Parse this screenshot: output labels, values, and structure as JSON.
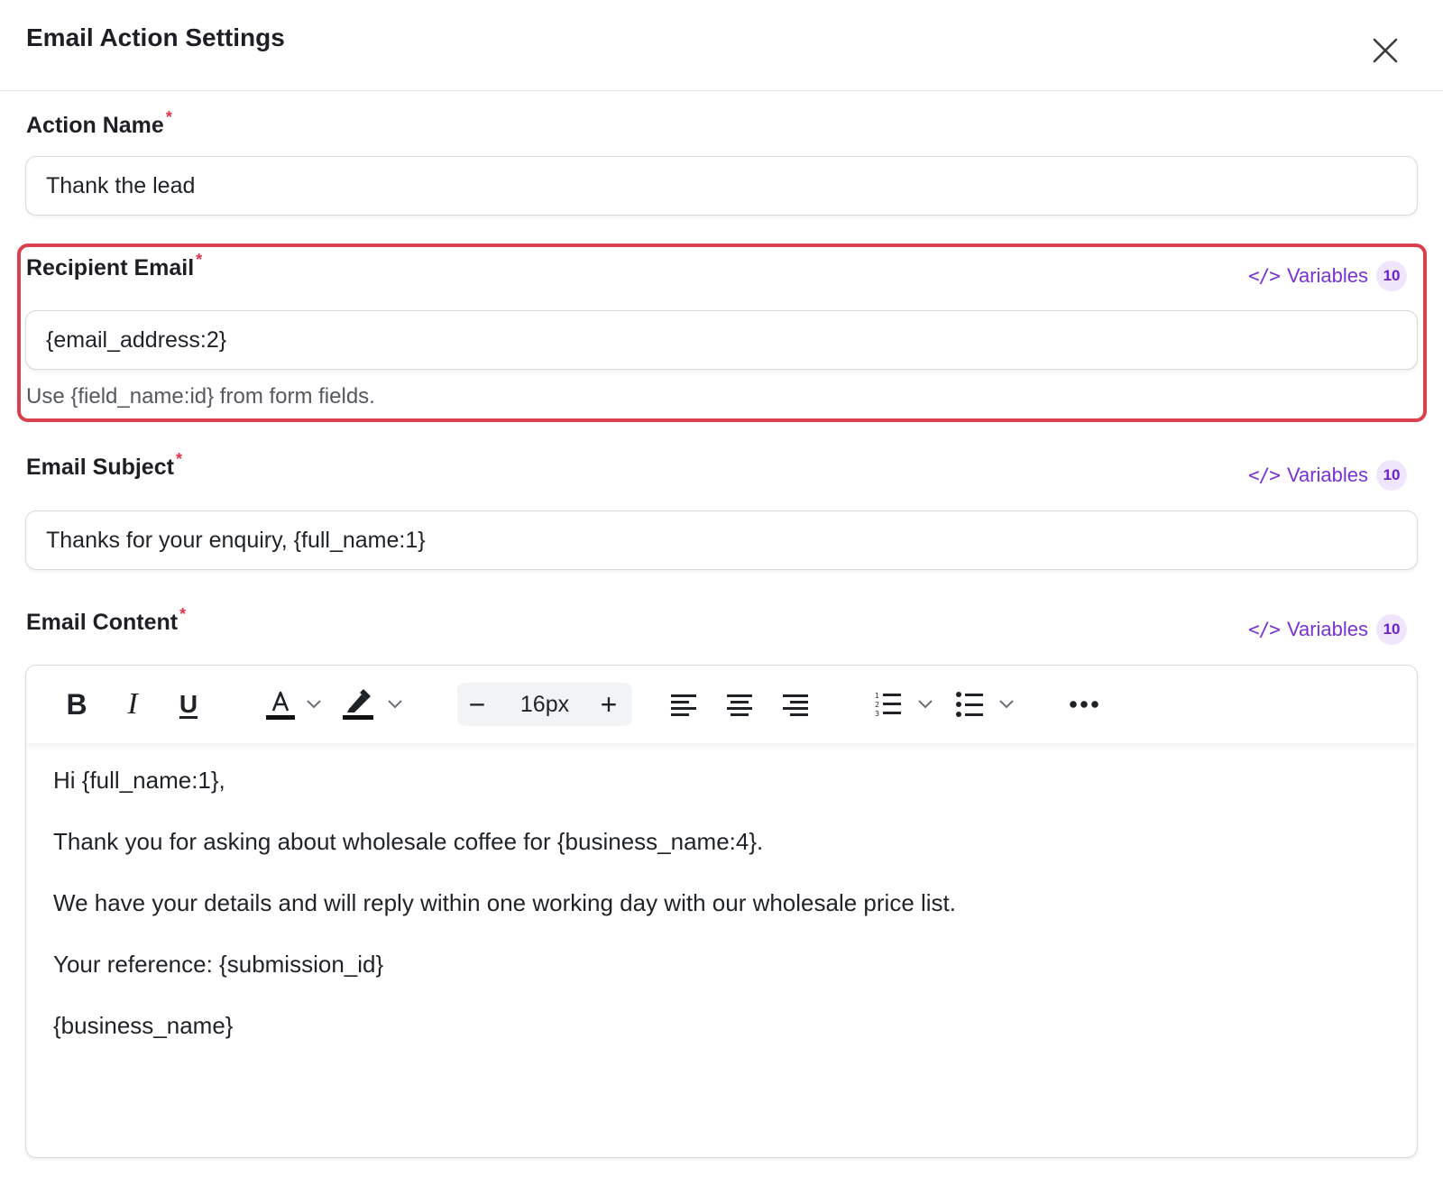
{
  "dialog": {
    "title": "Email Action Settings",
    "close_icon": "close-icon"
  },
  "fields": {
    "action_name": {
      "label": "Action Name",
      "required_mark": "*",
      "value": "Thank the lead"
    },
    "recipient_email": {
      "label": "Recipient Email",
      "required_mark": "*",
      "value": "{email_address:2}",
      "hint": "Use {field_name:id} from form fields.",
      "variables_label": "Variables",
      "variables_icon": "</>",
      "variables_count": "10"
    },
    "email_subject": {
      "label": "Email Subject",
      "required_mark": "*",
      "value": "Thanks for your enquiry, {full_name:1}",
      "variables_label": "Variables",
      "variables_icon": "</>",
      "variables_count": "10"
    },
    "email_content": {
      "label": "Email Content",
      "required_mark": "*",
      "variables_label": "Variables",
      "variables_icon": "</>",
      "variables_count": "10",
      "toolbar": {
        "bold": "B",
        "italic": "I",
        "underline": "U",
        "font_size": "16px",
        "minus": "−",
        "plus": "+"
      },
      "paragraphs": [
        "Hi {full_name:1},",
        "Thank you for asking about wholesale coffee for {business_name:4}.",
        "We have your details and will reply within one working day with our wholesale price list.",
        "Your reference: {submission_id}",
        "{business_name}"
      ]
    }
  },
  "colors": {
    "accent": "#7a32d6",
    "highlight": "#d9414f",
    "required": "#e0334b"
  }
}
